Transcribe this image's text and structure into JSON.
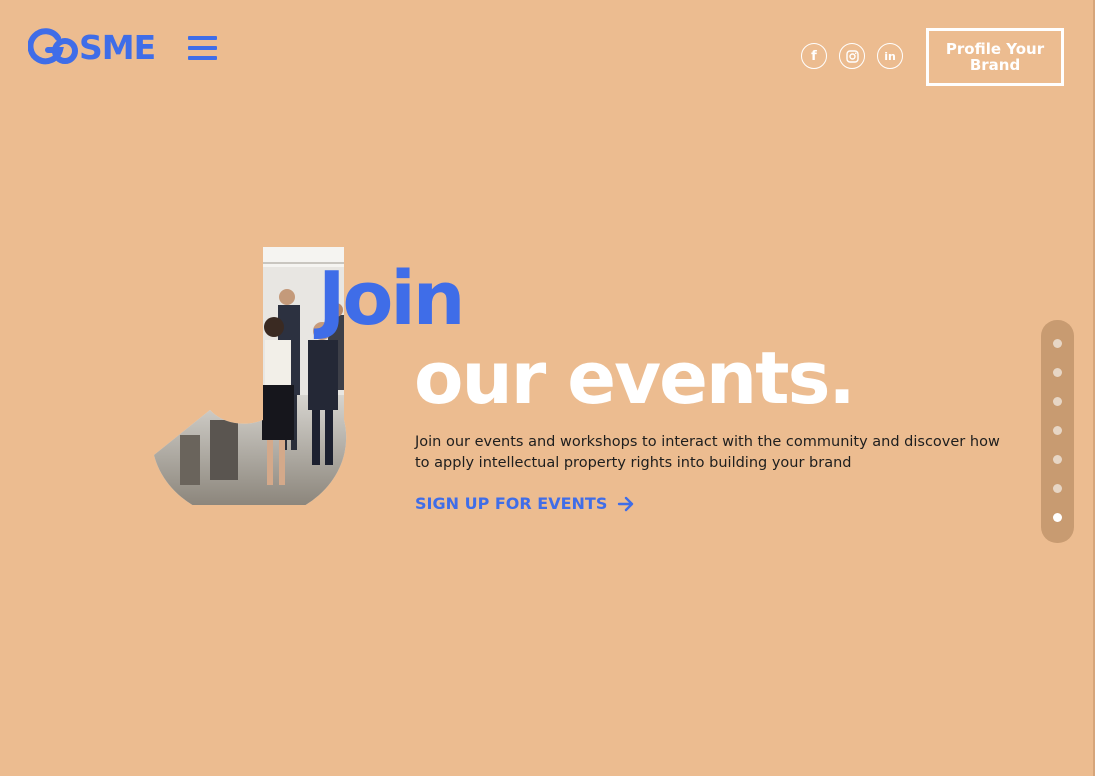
{
  "header": {
    "logo_go": "GO",
    "logo_sme": "SME",
    "menu_icon": "hamburger-menu-icon",
    "social": [
      {
        "name": "facebook-icon",
        "glyph": "f"
      },
      {
        "name": "instagram-icon",
        "glyph": ""
      },
      {
        "name": "linkedin-icon",
        "glyph": "in"
      }
    ],
    "cta_label": "Profile Your Brand"
  },
  "hero": {
    "title_line1": "Join",
    "title_line2": "our events.",
    "description": "Join our events and workshops to interact with the community and discover how to apply intellectual property rights into building your brand",
    "link_label": "SIGN UP FOR EVENTS",
    "link_icon": "arrow-right-icon"
  },
  "pager": {
    "total": 7,
    "active_index": 6
  },
  "colors": {
    "background": "#ecbc90",
    "accent": "#3f6de8",
    "text": "#1e1e1e",
    "white": "#ffffff"
  }
}
